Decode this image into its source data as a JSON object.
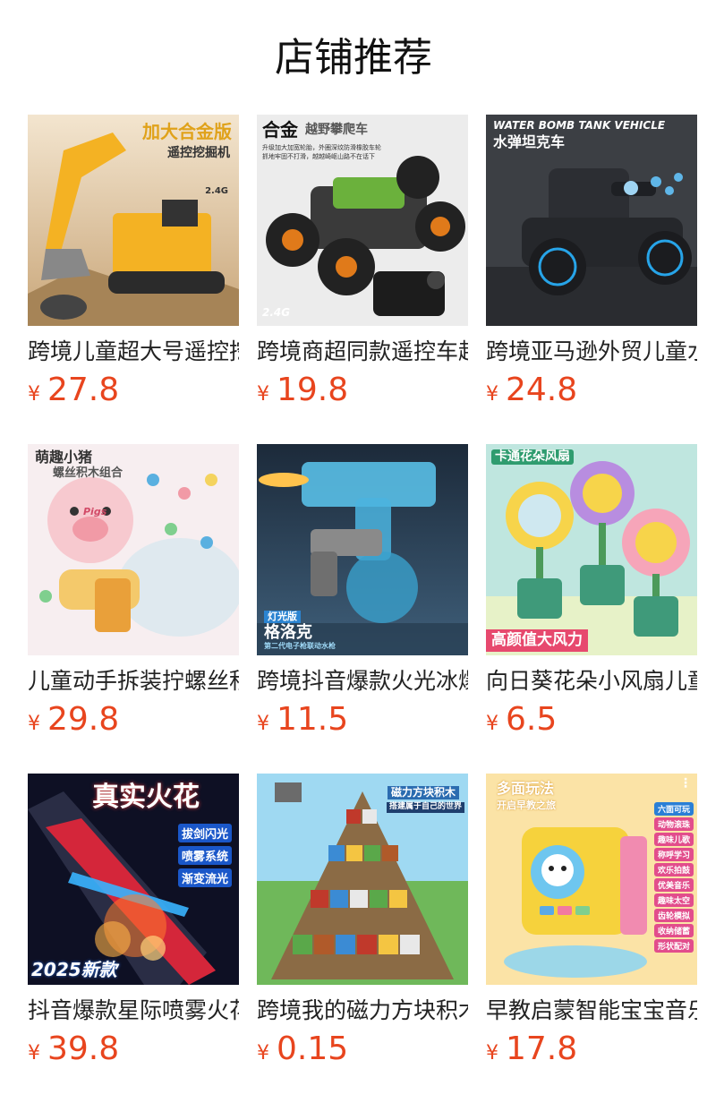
{
  "header": {
    "title": "店铺推荐"
  },
  "colors": {
    "price": "#e8451e"
  },
  "products": [
    {
      "name": "跨境儿童超大号遥控挖掘机",
      "currency": "¥",
      "price": "27.8",
      "overlay": {
        "headline": "加大合金版",
        "sub": "遥控挖掘机",
        "tag": "2.4G"
      }
    },
    {
      "name": "跨境商超同款遥控车越野攀爬车",
      "currency": "¥",
      "price": "19.8",
      "overlay": {
        "headline": "合金",
        "headline2": "越野攀爬车",
        "sub": "升级加大加宽轮胎，外圈深纹防滑橡胶车轮",
        "sub2": "抓地牢固不打滑，越越崎岖山路不在话下",
        "tag": "2.4G"
      }
    },
    {
      "name": "跨境亚马逊外贸儿童水弹坦克车",
      "currency": "¥",
      "price": "24.8",
      "overlay": {
        "headline": "WATER BOMB TANK VEHICLE",
        "sub": "水弹坦克车"
      }
    },
    {
      "name": "儿童动手拆装拧螺丝积木组合",
      "currency": "¥",
      "price": "29.8",
      "overlay": {
        "headline": "萌趣小猪",
        "sub": "螺丝积木组合",
        "tag": "Pigs"
      }
    },
    {
      "name": "跨境抖音爆款火光冰爆水枪",
      "currency": "¥",
      "price": "11.5",
      "overlay": {
        "headline": "格洛克",
        "tag": "灯光版",
        "sub": "第二代电子枪联动水枪"
      }
    },
    {
      "name": "向日葵花朵小风扇儿童桌面",
      "currency": "¥",
      "price": "6.5",
      "overlay": {
        "headline": "卡通花朵风扇",
        "sub": "高颜值大风力"
      }
    },
    {
      "name": "抖音爆款星际喷雾火花剑",
      "currency": "¥",
      "price": "39.8",
      "overlay": {
        "headline": "真实火花",
        "tags": [
          "拔剑闪光",
          "喷雾系统",
          "渐变流光"
        ],
        "sub": "2025新款"
      }
    },
    {
      "name": "跨境我的磁力方块积木",
      "currency": "¥",
      "price": "0.15",
      "overlay": {
        "headline": "磁力方块积木",
        "sub": "搭建属于自己的世界"
      }
    },
    {
      "name": "早教启蒙智能宝宝音乐六面盒",
      "currency": "¥",
      "price": "17.8",
      "overlay": {
        "headline": "多面玩法",
        "sub": "开启早教之旅",
        "tags": [
          "六面可玩",
          "动物滚珠",
          "趣味儿歌",
          "称呼学习",
          "欢乐拍鼓",
          "优美音乐",
          "趣味太空",
          "齿轮模拟",
          "收纳储蓄",
          "形状配对"
        ]
      }
    }
  ]
}
